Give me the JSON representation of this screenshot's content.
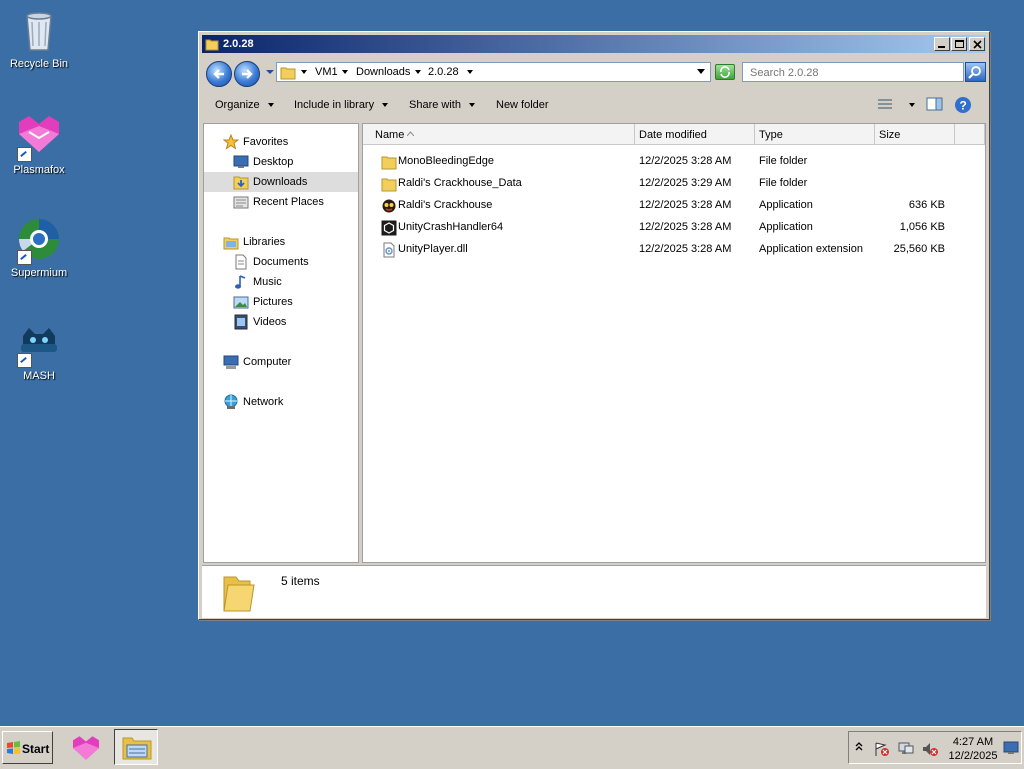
{
  "desktop": {
    "icons": [
      {
        "label": "Recycle Bin",
        "icon": "recycle-bin-icon"
      },
      {
        "label": "Plasmafox",
        "icon": "plasmafox-icon"
      },
      {
        "label": "Supermium",
        "icon": "supermium-icon"
      },
      {
        "label": "MASH",
        "icon": "mash-icon"
      }
    ],
    "background_color": "#3a6ea5"
  },
  "window": {
    "title": "2.0.28",
    "address": {
      "crumbs": [
        "VM1",
        "Downloads",
        "2.0.28"
      ]
    },
    "search": {
      "placeholder": "Search 2.0.28"
    },
    "commands": {
      "organize": "Organize",
      "include_in_library": "Include in library",
      "share_with": "Share with",
      "new_folder": "New folder"
    },
    "nav": {
      "favorites": "Favorites",
      "desktop": "Desktop",
      "downloads": "Downloads",
      "recent_places": "Recent Places",
      "libraries": "Libraries",
      "documents": "Documents",
      "music": "Music",
      "pictures": "Pictures",
      "videos": "Videos",
      "computer": "Computer",
      "network": "Network"
    },
    "columns": {
      "name": "Name",
      "date_modified": "Date modified",
      "type": "Type",
      "size": "Size"
    },
    "files": [
      {
        "name": "MonoBleedingEdge",
        "date": "12/2/2025 3:28 AM",
        "type": "File folder",
        "size": "",
        "icon": "folder-icon"
      },
      {
        "name": "Raldi's Crackhouse_Data",
        "date": "12/2/2025 3:29 AM",
        "type": "File folder",
        "size": "",
        "icon": "folder-icon"
      },
      {
        "name": "Raldi's Crackhouse",
        "date": "12/2/2025 3:28 AM",
        "type": "Application",
        "size": "636 KB",
        "icon": "game-app-icon"
      },
      {
        "name": "UnityCrashHandler64",
        "date": "12/2/2025 3:28 AM",
        "type": "Application",
        "size": "1,056 KB",
        "icon": "unity-app-icon"
      },
      {
        "name": "UnityPlayer.dll",
        "date": "12/2/2025 3:28 AM",
        "type": "Application extension",
        "size": "25,560 KB",
        "icon": "dll-file-icon"
      }
    ],
    "details": {
      "item_count": "5 items"
    }
  },
  "taskbar": {
    "start_label": "Start",
    "clock": {
      "time": "4:27 AM",
      "date": "12/2/2025"
    }
  },
  "colors": {
    "titlebar_start": "#0a246a",
    "titlebar_end": "#a6caf0",
    "selection": "#dddddd",
    "chrome": "#d4d0c8"
  }
}
